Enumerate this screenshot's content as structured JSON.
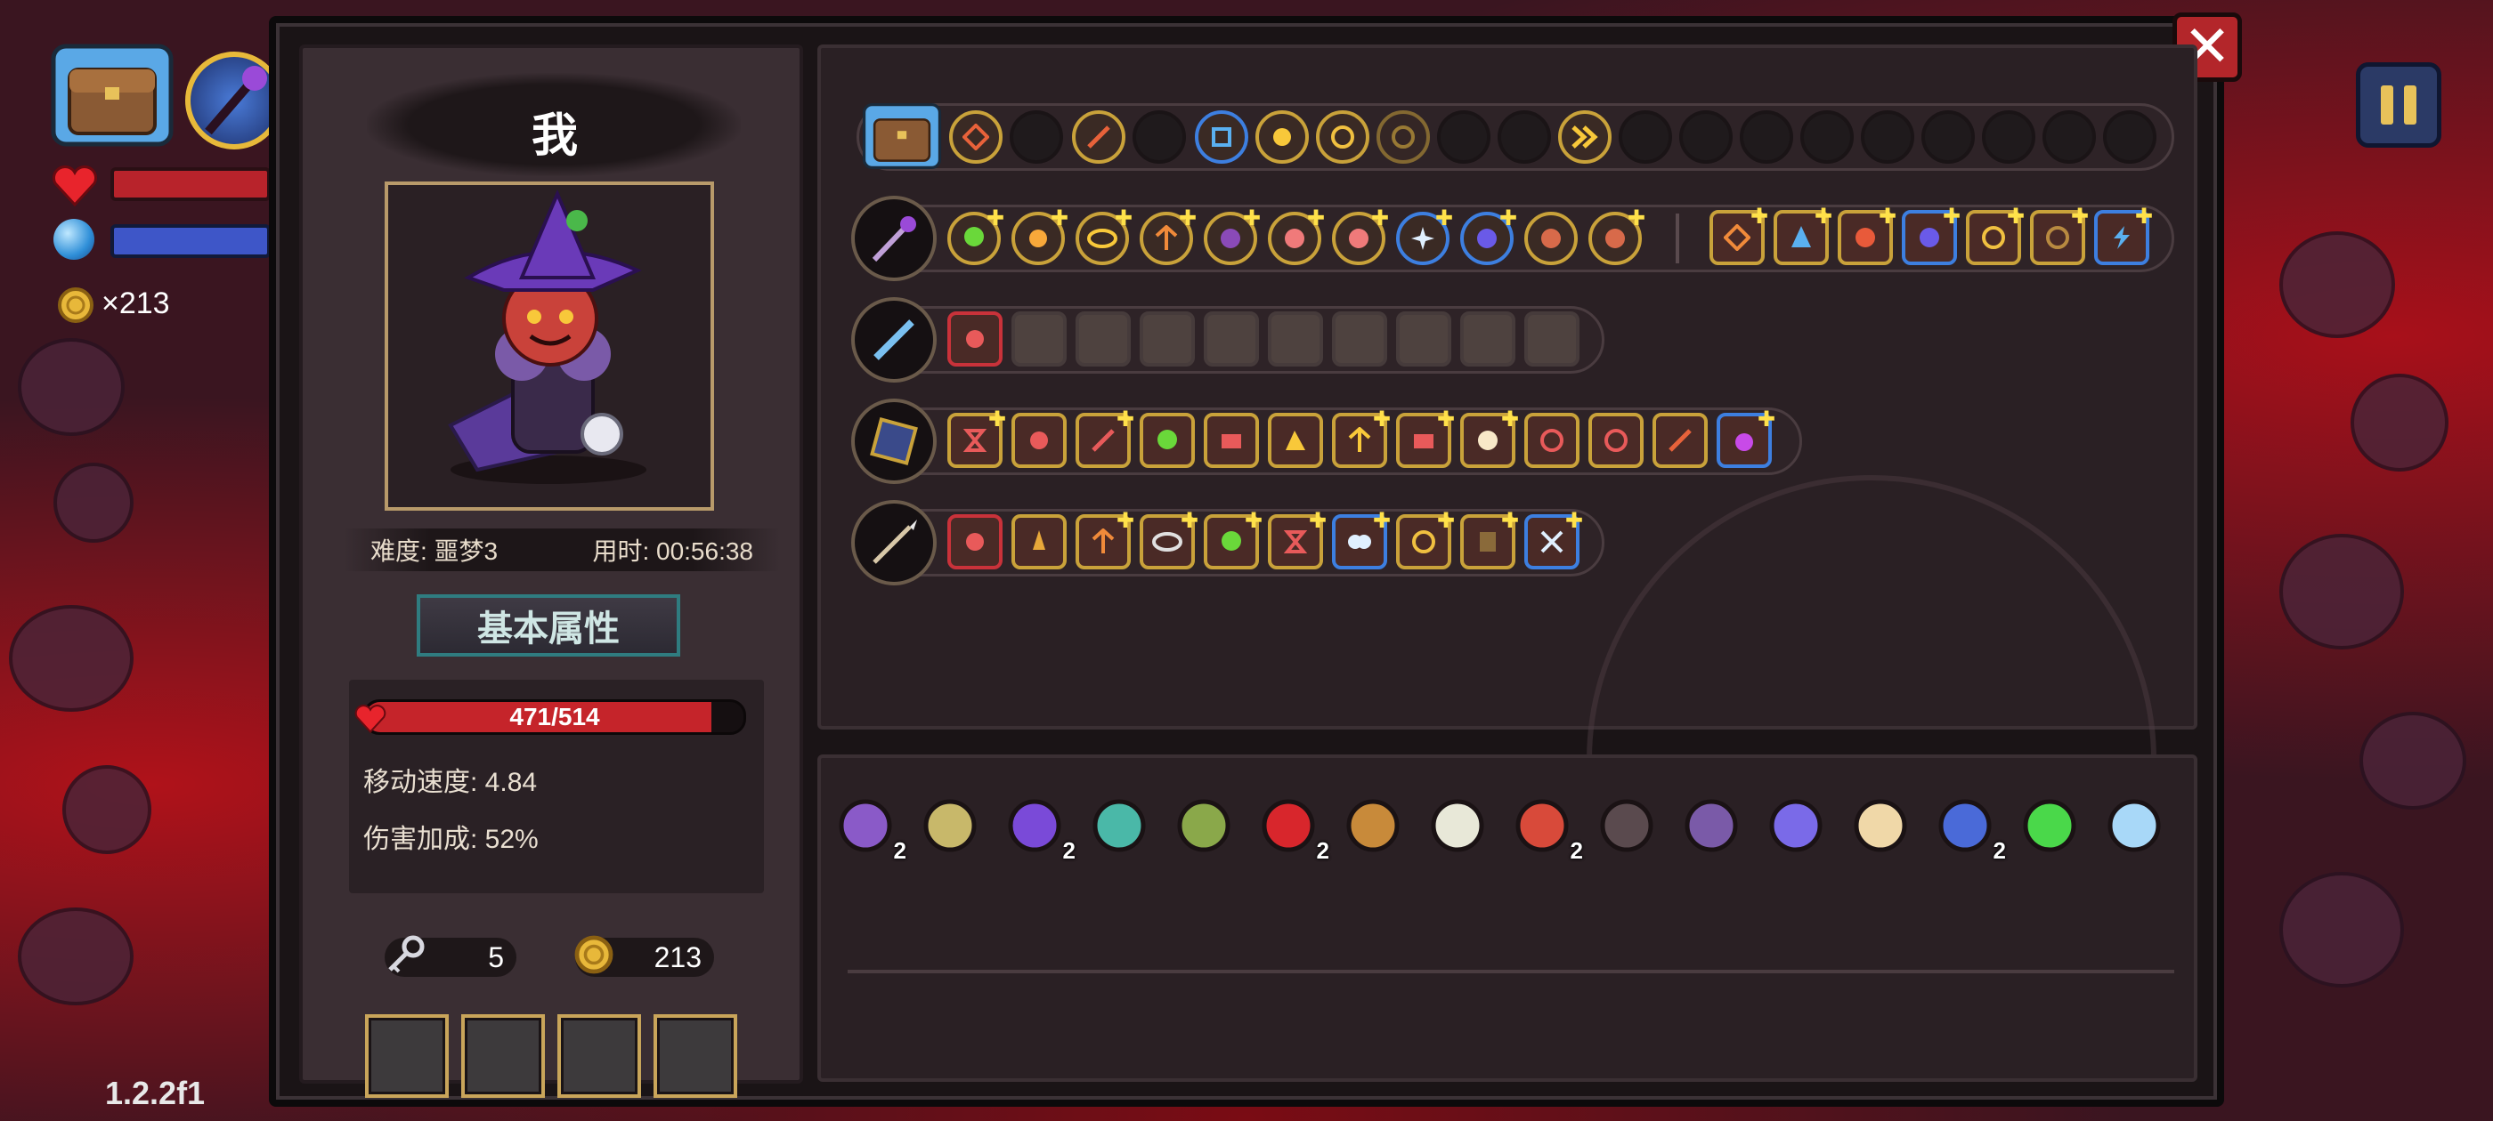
{
  "hud": {
    "coin_count": "×213",
    "version": "1.2.2f1"
  },
  "profile": {
    "player_name": "我",
    "difficulty": "难度: 噩梦3",
    "time_used": "用时: 00:56:38",
    "attributes_title": "基本属性",
    "hp_text": "471/514",
    "hp_fraction": 0.916,
    "move_speed": "移动速度: 4.84",
    "damage_bonus": "伤害加成: 52%",
    "keys": "5",
    "gold": "213"
  },
  "colors": {
    "gold_frame": "#c9a23a",
    "blue_frame": "#3d7fe0",
    "hp_red": "#c5242a",
    "attr_teal": "#2f7c80"
  },
  "icons": {
    "bag": "bag-icon",
    "staff": "staff-icon",
    "heart": "heart-icon",
    "mana_orb": "mana-orb-icon",
    "coin": "coin-icon",
    "key": "key-icon",
    "close": "close-icon",
    "pause": "pause-icon"
  },
  "skill_rows": [
    {
      "weapon": "bag-icon",
      "slots": 20
    },
    {
      "weapon": "staff-icon",
      "slots": 18
    },
    {
      "weapon": "sword-icon",
      "slots": 10
    },
    {
      "weapon": "spellbook-icon",
      "slots": 13
    },
    {
      "weapon": "spear-icon",
      "slots": 10
    }
  ],
  "items": [
    {
      "icon": "purple-hair-girl-icon",
      "count": "2"
    },
    {
      "icon": "dagger-icon",
      "count": ""
    },
    {
      "icon": "witch-hat-icon",
      "count": "2"
    },
    {
      "icon": "dice-icon",
      "count": ""
    },
    {
      "icon": "hand-staff-icon",
      "count": ""
    },
    {
      "icon": "red-eye-icon",
      "count": "2"
    },
    {
      "icon": "gauntlet-icon",
      "count": ""
    },
    {
      "icon": "fangs-icon",
      "count": ""
    },
    {
      "icon": "demon-mask-icon",
      "count": "2"
    },
    {
      "icon": "cloak-icon",
      "count": ""
    },
    {
      "icon": "rune-tablet-icon",
      "count": ""
    },
    {
      "icon": "crystal-icon",
      "count": ""
    },
    {
      "icon": "magnifier-icon",
      "count": ""
    },
    {
      "icon": "blue-glove-icon",
      "count": "2"
    },
    {
      "icon": "clover-icon",
      "count": ""
    },
    {
      "icon": "diamond-icon",
      "count": ""
    }
  ]
}
